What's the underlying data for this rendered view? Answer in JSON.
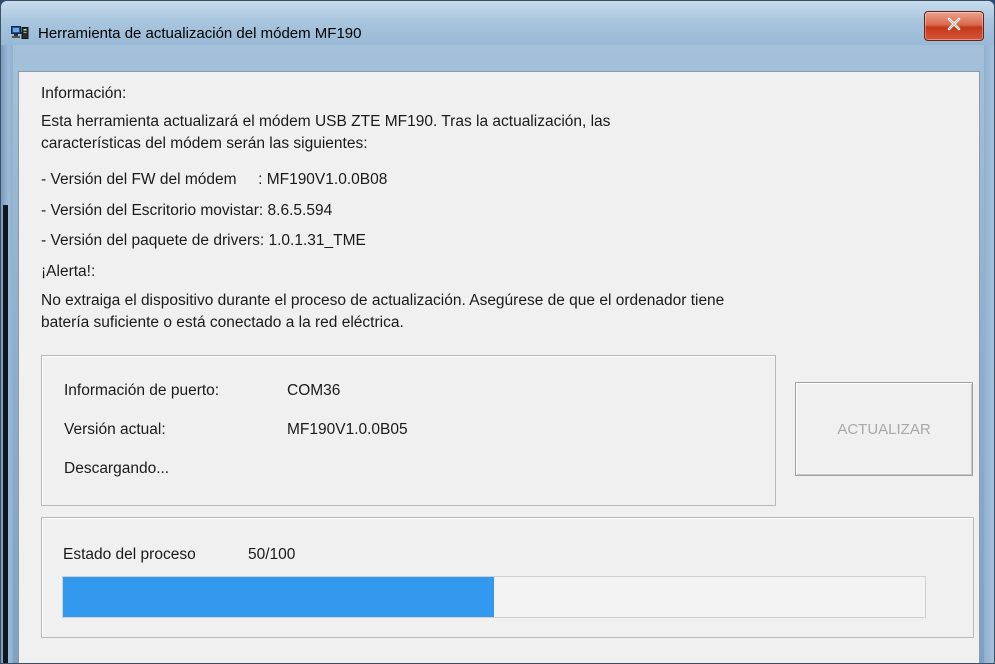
{
  "window": {
    "title": "Herramienta de actualización del módem MF190",
    "close_label": "x"
  },
  "info": {
    "heading": "Información:",
    "description_line1": "Esta herramienta actualizará el módem USB ZTE MF190. Tras la actualización, las",
    "description_line2": "características del módem serán las siguientes:",
    "fw_version": "- Versión del FW del módem     : MF190V1.0.0B08",
    "desktop_version": "- Versión del Escritorio movistar: 8.6.5.594",
    "driver_version": "- Versión del paquete de drivers: 1.0.1.31_TME"
  },
  "alert": {
    "heading": "¡Alerta!:",
    "message_line1": "No extraiga el dispositivo durante el proceso de actualización. Asegúrese de que el ordenador tiene",
    "message_line2": "batería suficiente o está conectado a la red eléctrica."
  },
  "port_box": {
    "port_label": "Información de puerto:",
    "port_value": "COM36",
    "version_label": "Versión actual:",
    "version_value": "MF190V1.0.0B05",
    "status_text": "Descargando..."
  },
  "update_button": {
    "label": "ACTUALIZAR",
    "enabled": false
  },
  "progress": {
    "label": "Estado del proceso",
    "value_text": "50/100",
    "fraction": 0.5,
    "fill_color": "#3399ee"
  },
  "icons": {
    "app": "modem-computer-icon",
    "close": "close-icon"
  }
}
